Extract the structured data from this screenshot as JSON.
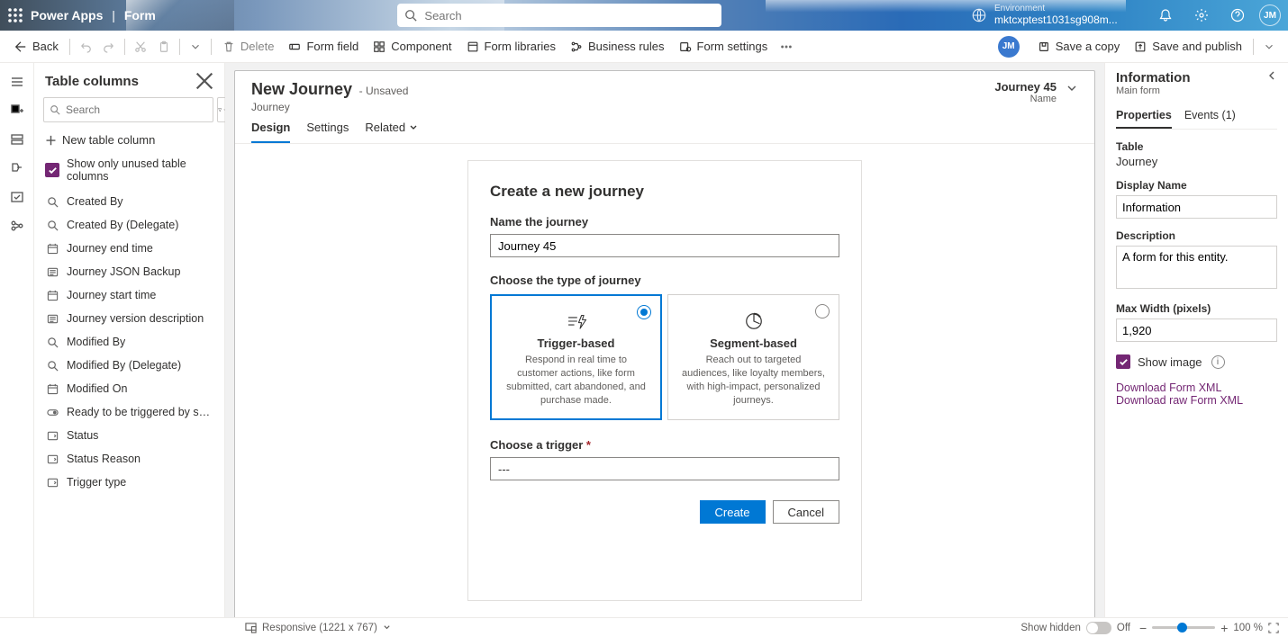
{
  "header": {
    "app": "Power Apps",
    "page": "Form",
    "search_placeholder": "Search",
    "env_label": "Environment",
    "env_name": "mktcxptest1031sg908m...",
    "avatar_initials": "JM"
  },
  "cmdbar": {
    "back": "Back",
    "delete": "Delete",
    "form_field": "Form field",
    "component": "Component",
    "form_libraries": "Form libraries",
    "business_rules": "Business rules",
    "form_settings": "Form settings",
    "save_copy": "Save a copy",
    "save_publish": "Save and publish",
    "avatar_initials": "JM"
  },
  "left_panel": {
    "title": "Table columns",
    "search_placeholder": "Search",
    "new_column": "New table column",
    "show_only": "Show only unused table columns",
    "columns": [
      {
        "label": "Created By",
        "icon": "lookup"
      },
      {
        "label": "Created By (Delegate)",
        "icon": "lookup"
      },
      {
        "label": "Journey end time",
        "icon": "datetime"
      },
      {
        "label": "Journey JSON Backup",
        "icon": "text"
      },
      {
        "label": "Journey start time",
        "icon": "datetime"
      },
      {
        "label": "Journey version description",
        "icon": "text"
      },
      {
        "label": "Modified By",
        "icon": "lookup"
      },
      {
        "label": "Modified By (Delegate)",
        "icon": "lookup"
      },
      {
        "label": "Modified On",
        "icon": "datetime"
      },
      {
        "label": "Ready to be triggered by segment r...",
        "icon": "twooption"
      },
      {
        "label": "Status",
        "icon": "optionset"
      },
      {
        "label": "Status Reason",
        "icon": "optionset"
      },
      {
        "label": "Trigger type",
        "icon": "optionset"
      }
    ]
  },
  "canvas": {
    "title": "New Journey",
    "unsaved": "- Unsaved",
    "entity": "Journey",
    "record": "Journey 45",
    "record_label": "Name",
    "tabs": {
      "design": "Design",
      "settings": "Settings",
      "related": "Related"
    },
    "card": {
      "title": "Create a new journey",
      "name_label": "Name the journey",
      "name_value": "Journey 45",
      "type_label": "Choose the type of journey",
      "trigger_title": "Trigger-based",
      "trigger_desc": "Respond in real time to customer actions, like form submitted, cart abandoned, and purchase made.",
      "segment_title": "Segment-based",
      "segment_desc": "Reach out to targeted audiences, like loyalty members, with high-impact, personalized journeys.",
      "choose_trigger_label": "Choose a trigger",
      "choose_trigger_value": "---",
      "create": "Create",
      "cancel": "Cancel"
    }
  },
  "right_panel": {
    "title": "Information",
    "subtitle": "Main form",
    "tab_props": "Properties",
    "tab_events": "Events (1)",
    "table_lbl": "Table",
    "table_val": "Journey",
    "display_lbl": "Display Name",
    "display_val": "Information",
    "desc_lbl": "Description",
    "desc_val": "A form for this entity.",
    "maxw_lbl": "Max Width (pixels)",
    "maxw_val": "1,920",
    "show_image": "Show image",
    "dl_xml": "Download Form XML",
    "dl_raw": "Download raw Form XML"
  },
  "statusbar": {
    "responsive": "Responsive (1221 x 767)",
    "show_hidden": "Show hidden",
    "off": "Off",
    "zoom": "100 %"
  }
}
